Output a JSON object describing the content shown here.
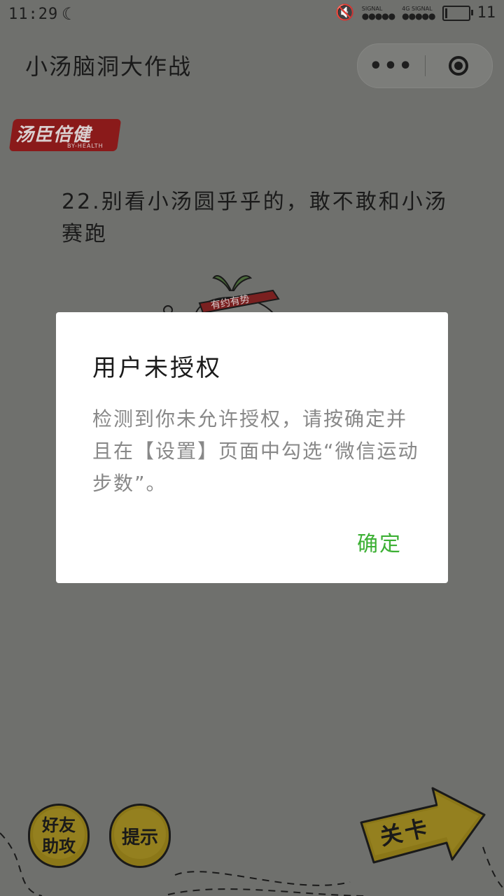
{
  "status_bar": {
    "time": "11:29",
    "signal_label_1": "SIGNAL",
    "signal_label_2": "SIGNAL",
    "network": "4G",
    "battery_level": "11",
    "battery_fraction": 0.11
  },
  "header": {
    "title": "小汤脑洞大作战",
    "more_icon": "more-dots-icon",
    "close_icon": "target-icon"
  },
  "brand": {
    "name": "汤臣倍健",
    "sub": "BY-HEALTH"
  },
  "question": {
    "text": "22.别看小汤圆乎乎的，敢不敢和小汤赛跑"
  },
  "mascot": {
    "banner_text": "有约有势"
  },
  "modal": {
    "title": "用户未授权",
    "body": "检测到你未允许授权，请按确定并且在【设置】页面中勾选“微信运动步数”。",
    "confirm_label": "确定"
  },
  "bottom": {
    "help_line1": "好友",
    "help_line2": "助攻",
    "hint_label": "提示",
    "level_label": "关卡"
  },
  "colors": {
    "overlay_bg": "#6f706d",
    "confirm": "#3cb034",
    "button_gold": "#8b7718",
    "brand_red": "#8a1a1a"
  }
}
